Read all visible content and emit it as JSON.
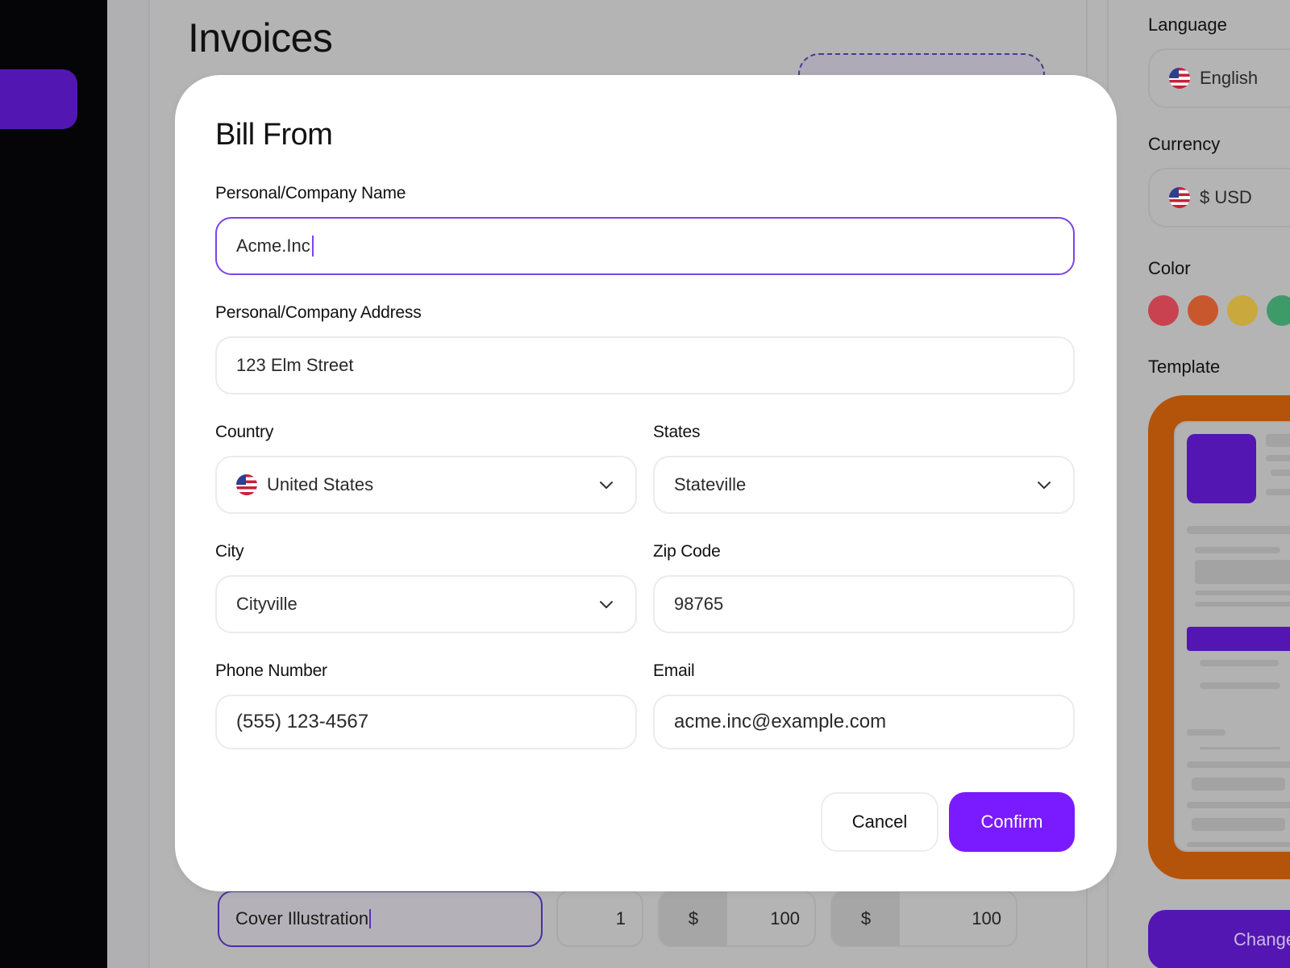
{
  "app": {
    "page_title": "Invoices"
  },
  "modal": {
    "title": "Bill From",
    "fields": {
      "name": {
        "label": "Personal/Company Name",
        "value": "Acme.Inc"
      },
      "address": {
        "label": "Personal/Company Address",
        "value": "123 Elm Street"
      },
      "country": {
        "label": "Country",
        "value": "United States",
        "flag_icon": "us-flag-icon"
      },
      "state": {
        "label": "States",
        "value": "Stateville"
      },
      "city": {
        "label": "City",
        "value": "Cityville"
      },
      "zip": {
        "label": "Zip Code",
        "value": "98765"
      },
      "phone": {
        "label": "Phone Number",
        "value": "(555) 123-4567"
      },
      "email": {
        "label": "Email",
        "value": "acme.inc@example.com"
      }
    },
    "buttons": {
      "cancel": "Cancel",
      "confirm": "Confirm"
    }
  },
  "line_item": {
    "description": "Cover Illustration",
    "quantity": "1",
    "rate_currency": "$",
    "rate": "100",
    "amount_currency": "$",
    "amount": "100"
  },
  "settings": {
    "language": {
      "label": "Language",
      "value": "English"
    },
    "currency": {
      "label": "Currency",
      "value": "$ USD"
    },
    "color": {
      "label": "Color",
      "swatches": [
        "#c9424f",
        "#c9572e",
        "#c9a83e",
        "#3f9a6a"
      ]
    },
    "template": {
      "label": "Template"
    },
    "change_button": "Change"
  },
  "colors": {
    "accent": "#7a1bff",
    "accent_dim": "#5416b2",
    "focus_border": "#7a45e8",
    "template_frame": "#b4540a"
  }
}
